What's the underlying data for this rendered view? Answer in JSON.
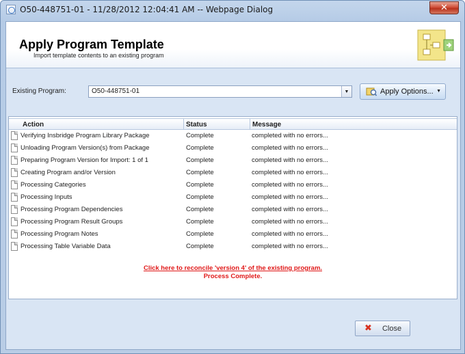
{
  "window": {
    "title": "O50-448751-01 - 11/28/2012 12:04:41 AM -- Webpage Dialog",
    "close_glyph": "✕"
  },
  "header": {
    "title": "Apply Program Template",
    "subtitle": "Import template contents to an existing program",
    "icon": "template-flowchart-icon"
  },
  "program": {
    "label": "Existing Program:",
    "selected": "O50-448751-01",
    "apply_options_label": "Apply Options...",
    "apply_icon": "apply-options-icon"
  },
  "grid": {
    "columns": [
      "Action",
      "Status",
      "Message"
    ],
    "rows": [
      {
        "action": "Verifying Insbridge Program Library Package",
        "status": "Complete",
        "message": "completed with no errors..."
      },
      {
        "action": "Unloading Program Version(s) from Package",
        "status": "Complete",
        "message": "completed with no errors..."
      },
      {
        "action": "Preparing Program Version for Import: 1 of 1",
        "status": "Complete",
        "message": "completed with no errors..."
      },
      {
        "action": "Creating Program and/or Version",
        "status": "Complete",
        "message": "completed with no errors..."
      },
      {
        "action": "Processing Categories",
        "status": "Complete",
        "message": "completed with no errors..."
      },
      {
        "action": "Processing Inputs",
        "status": "Complete",
        "message": "completed with no errors..."
      },
      {
        "action": "Processing Program Dependencies",
        "status": "Complete",
        "message": "completed with no errors..."
      },
      {
        "action": "Processing Program Result Groups",
        "status": "Complete",
        "message": "completed with no errors..."
      },
      {
        "action": "Processing Program Notes",
        "status": "Complete",
        "message": "completed with no errors..."
      },
      {
        "action": "Processing Table Variable Data",
        "status": "Complete",
        "message": "completed with no errors..."
      }
    ],
    "reconcile_link": "Click here to reconcile 'version 4' of the existing program.",
    "process_status": "Process Complete."
  },
  "footer": {
    "close_label": "Close"
  },
  "colors": {
    "link_red": "#e01818",
    "frame_blue": "#b9cde6"
  }
}
